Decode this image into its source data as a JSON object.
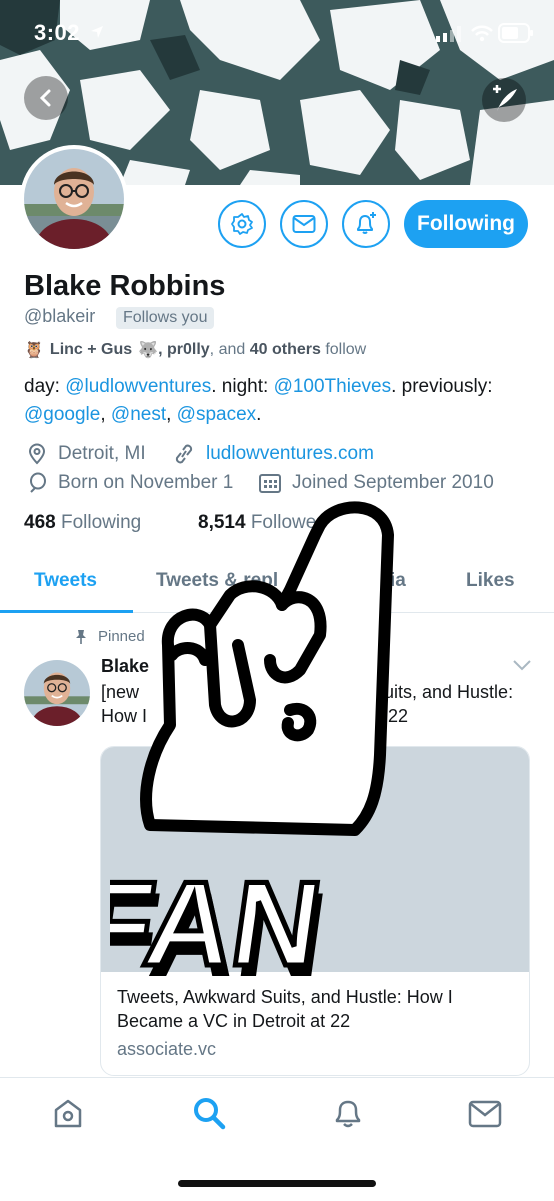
{
  "status_bar": {
    "time": "3:02"
  },
  "profile": {
    "name": "Blake Robbins",
    "handle": "@blakeir",
    "follows_you": "Follows you",
    "follow_button": "Following",
    "followed_by": {
      "name1": "Linc + Gus",
      "name2": ", pr0lly",
      "and_text": ", and",
      "others": "40 others",
      "suffix": "follow"
    },
    "bio": {
      "p1": "day: ",
      "l1": "@ludlowventures",
      "p2": ". night: ",
      "l2": "@100Thieves",
      "p3": ". previously: ",
      "l3": "@google",
      "p4": ", ",
      "l4": "@nest",
      "p5": ", ",
      "l5": "@spacex",
      "p6": "."
    },
    "location": "Detroit, MI",
    "website": "ludlowventures.com",
    "birthday": "Born on November 1",
    "joined": "Joined September 2010",
    "following_count": "468",
    "following_label": "Following",
    "followers_count": "8,514",
    "followers_label": "Followe"
  },
  "tabs": [
    {
      "label": "Tweets"
    },
    {
      "label": "Tweets & repl"
    },
    {
      "label": "ia"
    },
    {
      "label": "Likes"
    }
  ],
  "tweet": {
    "pinned_label": "Pinned",
    "author": "Blake",
    "author_suffix": "s",
    "text_line1_left": "[new",
    "text_line1_right": "uits, and Hustle:",
    "text_line2_left": "How I",
    "text_line2_right": "at 22",
    "card_title": "Tweets, Awkward Suits, and Hustle: How I Became a VC in Detroit at 22",
    "card_domain": "associate.vc"
  },
  "overlay": {
    "text": "FAN"
  },
  "colors": {
    "accent": "#1da1f2",
    "link": "#1b95e0",
    "muted": "#657786"
  }
}
